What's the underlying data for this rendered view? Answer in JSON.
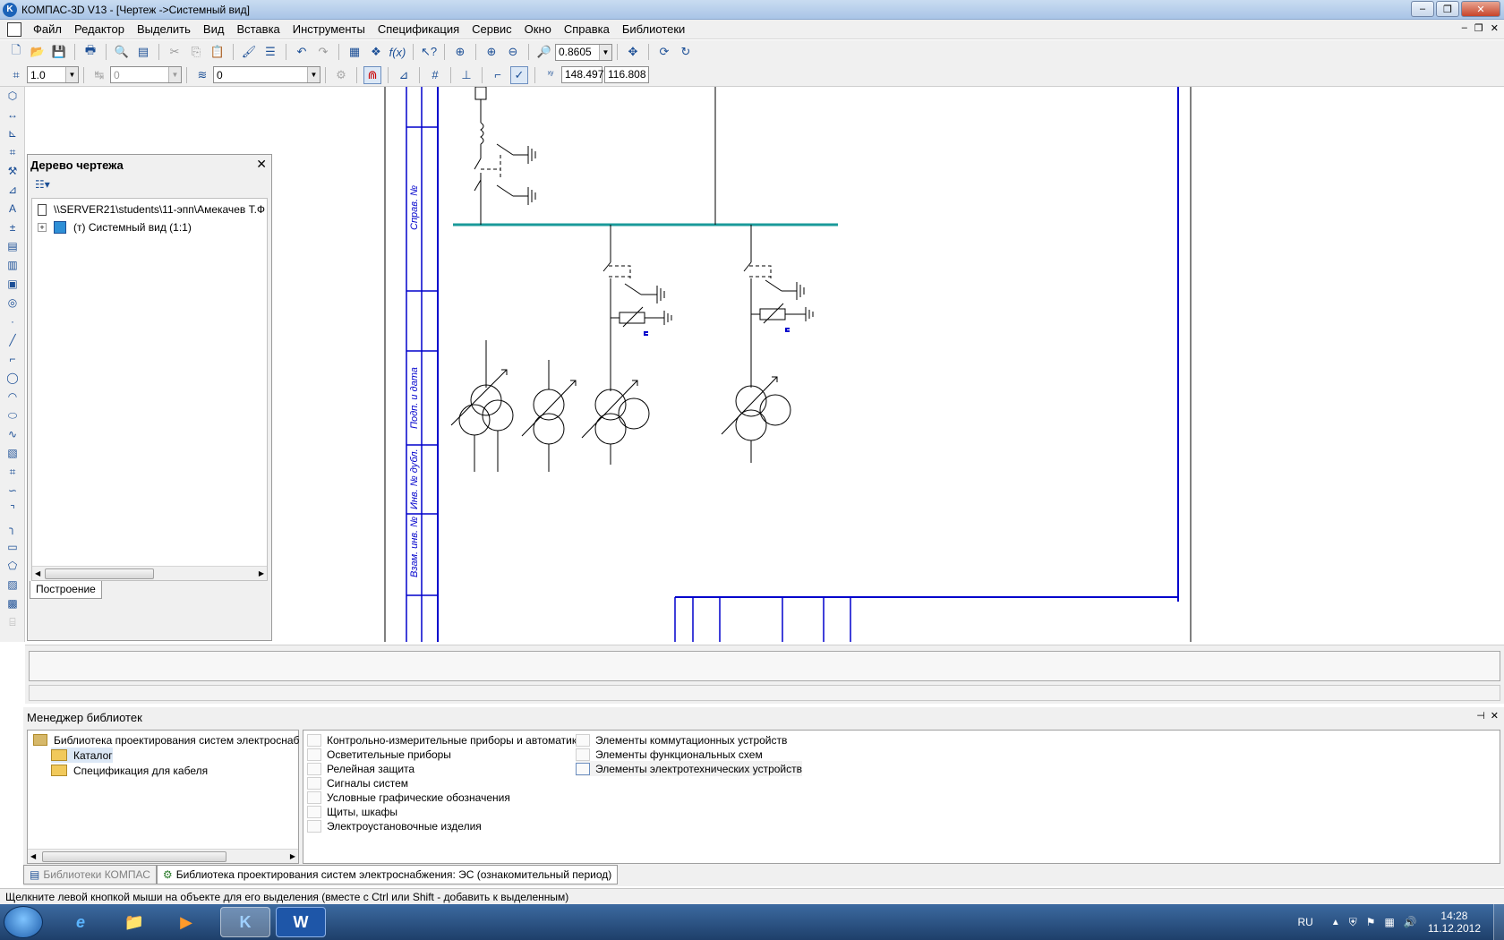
{
  "window": {
    "title": "КОМПАС-3D V13 - [Чертеж ->Системный вид]",
    "app_icon_letter": "K",
    "buttons": {
      "minimize": "–",
      "restore": "❐",
      "close": "✕"
    }
  },
  "menu": {
    "items": [
      "Файл",
      "Редактор",
      "Выделить",
      "Вид",
      "Вставка",
      "Инструменты",
      "Спецификация",
      "Сервис",
      "Окно",
      "Справка",
      "Библиотеки"
    ],
    "mdi_buttons": [
      "–",
      "❐",
      "✕"
    ]
  },
  "toolbar1": {
    "zoom_value": "0.8605"
  },
  "toolbar2": {
    "scale_value": "1.0",
    "style_value": "0",
    "layer_value": "0",
    "coord_x": "148.497",
    "coord_y": "116.808"
  },
  "tree_panel": {
    "title": "Дерево чертежа",
    "close": "✕",
    "root_item": "\\\\SERVER21\\students\\11-эпп\\Амекачев Т.Ф",
    "child_item": "(т) Системный вид (1:1)",
    "tab": "Построение",
    "expander": "+"
  },
  "drawing": {
    "stamp_labels": [
      "Справ. №",
      "Подп. и дата",
      "Инв. № дубл.",
      "Взам. инв. №"
    ],
    "colors": {
      "frame": "#0000cc",
      "bus": "#1a9a9a",
      "lines": "#000000",
      "marker": "#0000cc"
    }
  },
  "library_manager": {
    "title": "Менеджер библиотек",
    "header_buttons": [
      "⊣",
      "✕"
    ],
    "tree": {
      "root": "Библиотека проектирования систем электроснаб",
      "children": [
        "Каталог",
        "Спецификация для кабеля"
      ]
    },
    "items_col1": [
      "Контрольно-измерительные приборы и автоматика",
      "Осветительные приборы",
      "Релейная защита",
      "Сигналы систем",
      "Условные графические обозначения",
      "Щиты, шкафы",
      "Электроустановочные изделия"
    ],
    "items_col2": [
      "Элементы коммутационных устройств",
      "Элементы функциональных схем",
      "Элементы электротехнических устройств"
    ],
    "tabs": [
      {
        "label": "Библиотеки КОМПАС",
        "active": false
      },
      {
        "label": "Библиотека проектирования систем электроснабжения: ЭС (ознакомительный период)",
        "active": true
      }
    ]
  },
  "status_bar": {
    "text": "Щелкните левой кнопкой мыши на объекте для его выделения (вместе с Ctrl или Shift - добавить к выделенным)"
  },
  "taskbar": {
    "tasks": [
      "e",
      "📁",
      "▶",
      "K",
      "W"
    ],
    "language": "RU",
    "time": "14:28",
    "date": "11.12.2012"
  }
}
